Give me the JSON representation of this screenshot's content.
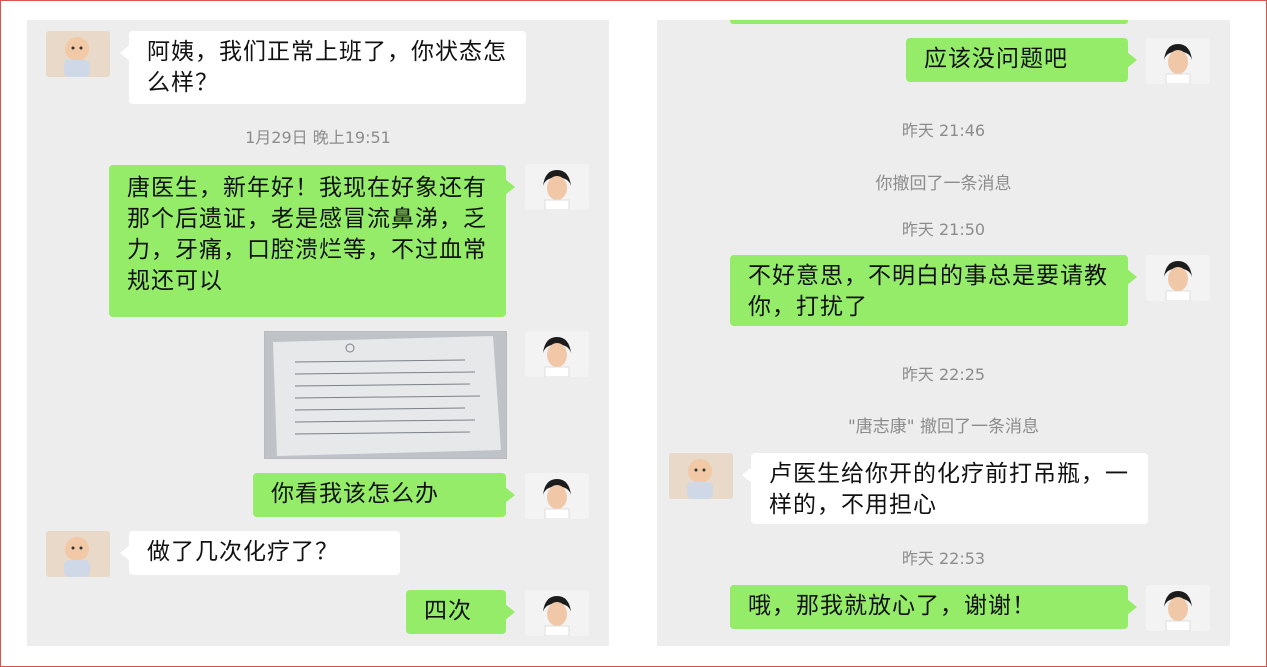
{
  "left_chat": {
    "msg1": {
      "sender": "contact",
      "text": "阿姨，我们正常上班了，你状态怎么样？"
    },
    "timestamp1": "1月29日 晚上19:51",
    "msg2": {
      "sender": "self",
      "text": "唐医生，新年好！我现在好象还有那个后遗证，老是感冒流鼻涕，乏力，牙痛，口腔溃烂等，不过血常规还可以"
    },
    "msg3": {
      "sender": "self",
      "type": "image",
      "icon": "document-photo"
    },
    "msg4": {
      "sender": "self",
      "text": "你看我该怎么办"
    },
    "msg5": {
      "sender": "contact",
      "text": "做了几次化疗了？"
    },
    "msg6": {
      "sender": "self",
      "text": "四次"
    }
  },
  "right_chat": {
    "msg1": {
      "sender": "self",
      "text": "应该没问题吧"
    },
    "timestamp1": "昨天 21:46",
    "system1": "你撤回了一条消息",
    "timestamp2": "昨天 21:50",
    "msg2": {
      "sender": "self",
      "text": "不好意思，不明白的事总是要请教你，打扰了"
    },
    "timestamp3": "昨天 22:25",
    "system2": "\"唐志康\" 撤回了一条消息",
    "msg3": {
      "sender": "contact",
      "text": "卢医生给你开的化疗前打吊瓶，一样的，不用担心"
    },
    "timestamp4": "昨天 22:53",
    "msg4": {
      "sender": "self",
      "text": "哦，那我就放心了，谢谢！"
    }
  },
  "colors": {
    "self_bubble": "#95ec69",
    "contact_bubble": "#ffffff",
    "chat_bg": "#ededed",
    "border": "#d9534f"
  }
}
